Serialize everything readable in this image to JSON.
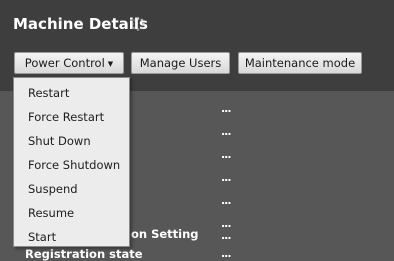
{
  "header": {
    "title": "Machine Details"
  },
  "toolbar": {
    "power_control_label": "Power Control",
    "manage_users_label": "Manage Users",
    "maintenance_mode_label": "Maintenance mode"
  },
  "power_menu": {
    "items": [
      "Restart",
      "Force Restart",
      "Shut Down",
      "Force Shutdown",
      "Suspend",
      "Resume",
      "Start"
    ]
  },
  "details": {
    "value_placeholder": "...",
    "partial_label": "on Setting",
    "registration_state_label": "Registration state"
  },
  "colors": {
    "header_bg": "#3e3e3e",
    "body_bg": "#575757",
    "menu_bg": "#ececec"
  }
}
